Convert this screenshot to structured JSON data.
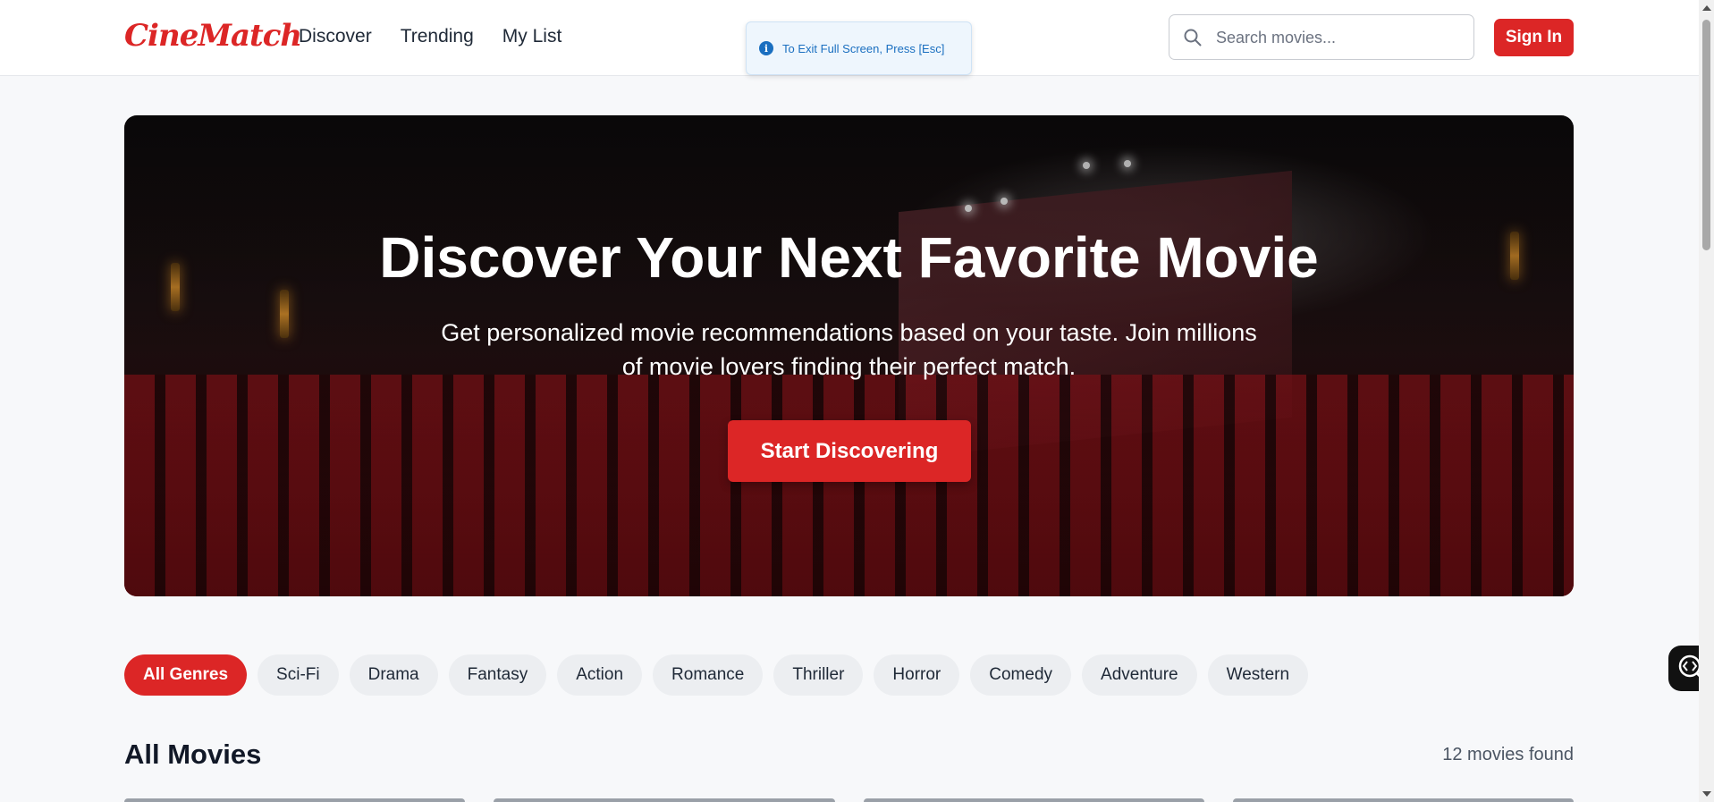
{
  "header": {
    "logo": "CineMatch",
    "nav": [
      "Discover",
      "Trending",
      "My List"
    ],
    "search_placeholder": "Search movies...",
    "signin_label": "Sign In"
  },
  "toast": {
    "text": "To Exit Full Screen, Press [Esc]",
    "icon": "info-icon"
  },
  "hero": {
    "title": "Discover Your Next Favorite Movie",
    "subtitle": "Get personalized movie recommendations based on your taste. Join millions of movie lovers finding their perfect match.",
    "cta_label": "Start Discovering"
  },
  "genres": {
    "items": [
      "All Genres",
      "Sci-Fi",
      "Drama",
      "Fantasy",
      "Action",
      "Romance",
      "Thriller",
      "Horror",
      "Comedy",
      "Adventure",
      "Western"
    ],
    "selected": "All Genres"
  },
  "movies": {
    "section_title": "All Movies",
    "count_text": "12 movies found"
  },
  "colors": {
    "brand": "#dc2626",
    "background": "#f7f8fa",
    "chip": "#eceef1",
    "toast_text": "#1a6fc0"
  }
}
